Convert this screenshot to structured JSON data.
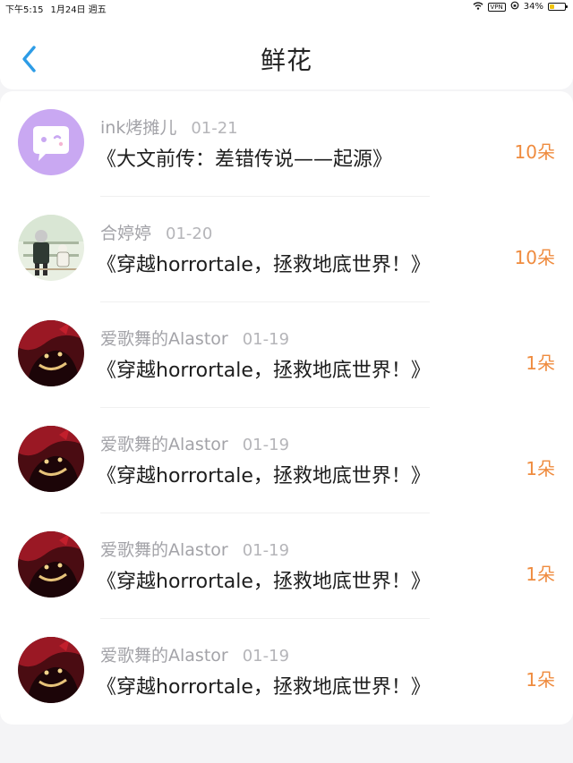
{
  "status_bar": {
    "time": "下午5:15",
    "date": "1月24日 週五",
    "vpn": "VPN",
    "battery": "34%",
    "battery_level": 0.34
  },
  "header": {
    "title": "鲜花"
  },
  "items": [
    {
      "user": "ink烤摊儿",
      "date": "01-21",
      "title": "《大文前传：差错传说——起源》",
      "flowers": "10朵",
      "avatar": "purple-chat-bubble"
    },
    {
      "user": "合婷婷",
      "date": "01-20",
      "title": "《穿越horrortale，拯救地底世界！》",
      "flowers": "10朵",
      "avatar": "illustration-characters"
    },
    {
      "user": "爱歌舞的Alastor",
      "date": "01-19",
      "title": "《穿越horrortale，拯救地底世界！》",
      "flowers": "1朵",
      "avatar": "red-character"
    },
    {
      "user": "爱歌舞的Alastor",
      "date": "01-19",
      "title": "《穿越horrortale，拯救地底世界！》",
      "flowers": "1朵",
      "avatar": "red-character"
    },
    {
      "user": "爱歌舞的Alastor",
      "date": "01-19",
      "title": "《穿越horrortale，拯救地底世界！》",
      "flowers": "1朵",
      "avatar": "red-character"
    },
    {
      "user": "爱歌舞的Alastor",
      "date": "01-19",
      "title": "《穿越horrortale，拯救地底世界！》",
      "flowers": "1朵",
      "avatar": "red-character"
    }
  ],
  "colors": {
    "accent_blue": "#2d9ce6",
    "flower_orange": "#ef8b3e",
    "meta_gray": "#a3a3a8",
    "page_background": "#f4f4f6"
  }
}
